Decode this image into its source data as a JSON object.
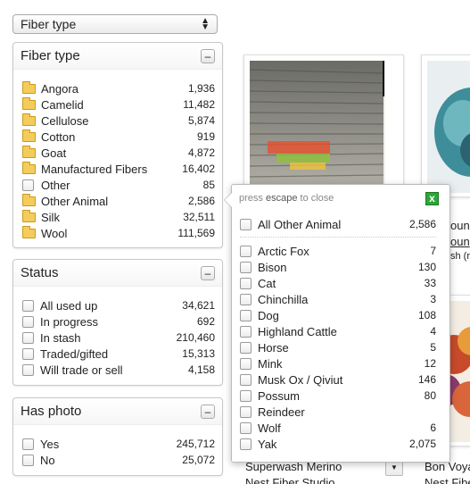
{
  "top_select": {
    "value": "Fiber type",
    "icon": "updown-arrows-icon"
  },
  "fiber_panel": {
    "title": "Fiber type",
    "collapse_label": "–",
    "items": [
      {
        "label": "Angora",
        "count": "1,936",
        "icon": "folder-icon"
      },
      {
        "label": "Camelid",
        "count": "11,482",
        "icon": "folder-icon"
      },
      {
        "label": "Cellulose",
        "count": "5,874",
        "icon": "folder-icon"
      },
      {
        "label": "Cotton",
        "count": "919",
        "icon": "folder-icon"
      },
      {
        "label": "Goat",
        "count": "4,872",
        "icon": "folder-icon"
      },
      {
        "label": "Manufactured Fibers",
        "count": "16,402",
        "icon": "folder-icon"
      },
      {
        "label": "Other",
        "count": "85",
        "icon": "checkbox"
      },
      {
        "label": "Other Animal",
        "count": "2,586",
        "icon": "folder-icon"
      },
      {
        "label": "Silk",
        "count": "32,511",
        "icon": "folder-icon"
      },
      {
        "label": "Wool",
        "count": "111,569",
        "icon": "folder-icon"
      }
    ]
  },
  "status_panel": {
    "title": "Status",
    "collapse_label": "–",
    "items": [
      {
        "label": "All used up",
        "count": "34,621"
      },
      {
        "label": "In progress",
        "count": "692"
      },
      {
        "label": "In stash",
        "count": "210,460"
      },
      {
        "label": "Traded/gifted",
        "count": "15,313"
      },
      {
        "label": "Will trade or sell",
        "count": "4,158"
      }
    ]
  },
  "photo_panel": {
    "title": "Has photo",
    "collapse_label": "–",
    "items": [
      {
        "label": "Yes",
        "count": "245,712"
      },
      {
        "label": "No",
        "count": "25,072"
      }
    ]
  },
  "popup": {
    "hint_pre": "press ",
    "hint_key": "escape",
    "hint_post": " to close",
    "close_label": "x",
    "all_item": {
      "label": "All Other Animal",
      "count": "2,586"
    },
    "items": [
      {
        "label": "Arctic Fox",
        "count": "7"
      },
      {
        "label": "Bison",
        "count": "130"
      },
      {
        "label": "Cat",
        "count": "33"
      },
      {
        "label": "Chinchilla",
        "count": "3"
      },
      {
        "label": "Dog",
        "count": "108"
      },
      {
        "label": "Highland Cattle",
        "count": "4"
      },
      {
        "label": "Horse",
        "count": "5"
      },
      {
        "label": "Mink",
        "count": "12"
      },
      {
        "label": "Musk Ox / Qiviut",
        "count": "146"
      },
      {
        "label": "Possum",
        "count": "80"
      },
      {
        "label": "Reindeer",
        "count": ""
      },
      {
        "label": "Wolf",
        "count": "6"
      },
      {
        "label": "Yak",
        "count": "2,075"
      }
    ]
  },
  "products": {
    "left_name": "Superwash Merino",
    "left_brand": "Nest Fiber Studio",
    "right_name": "Bon Voya",
    "right_brand": "Nest Fibe",
    "right_frag_1": "oun",
    "right_frag_2": "oun",
    "right_frag_3": "sh (r",
    "select_icon": "▼"
  }
}
